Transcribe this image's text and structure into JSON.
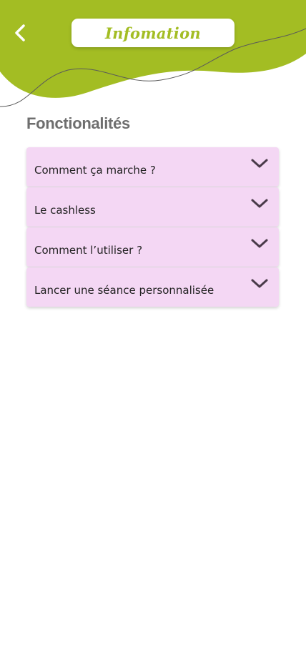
{
  "header": {
    "title": "Infomation",
    "back_icon": "chevron-left-icon",
    "accent_color": "#a3bd23"
  },
  "section": {
    "title": "Fonctionalités"
  },
  "faq": {
    "items": [
      {
        "label": "Comment ça marche ?",
        "icon": "chevron-down-icon"
      },
      {
        "label": "Le cashless",
        "icon": "chevron-down-icon"
      },
      {
        "label": "Comment l’utiliser ?",
        "icon": "chevron-down-icon"
      },
      {
        "label": "Lancer une séance personnalisée",
        "icon": "chevron-down-icon"
      }
    ],
    "item_color": "#f4d7f4"
  }
}
